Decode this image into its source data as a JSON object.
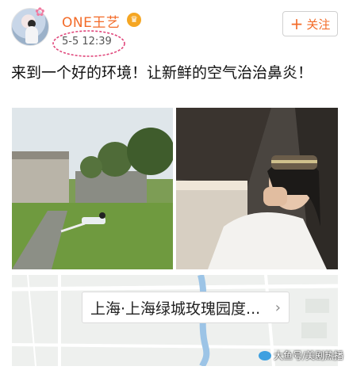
{
  "post": {
    "username": "ONE王艺",
    "vip_glyph": "♛",
    "timestamp": "5-5 12:39",
    "follow_label": "关注",
    "follow_plus": "+",
    "text": "来到一个好的环境！让新鲜的空气治治鼻炎！"
  },
  "location": {
    "label": "上海·上海绿城玫瑰园度...",
    "chevron": "›"
  },
  "watermark": {
    "text": "大鱼号/美剧热播"
  },
  "colors": {
    "username": "#f36b28",
    "follow": "#f36b28",
    "annotation_circle": "#e0457a"
  },
  "icons": [
    "avatar",
    "vip-crown-icon",
    "plus-icon",
    "chevron-right-icon",
    "fish-logo-icon"
  ]
}
